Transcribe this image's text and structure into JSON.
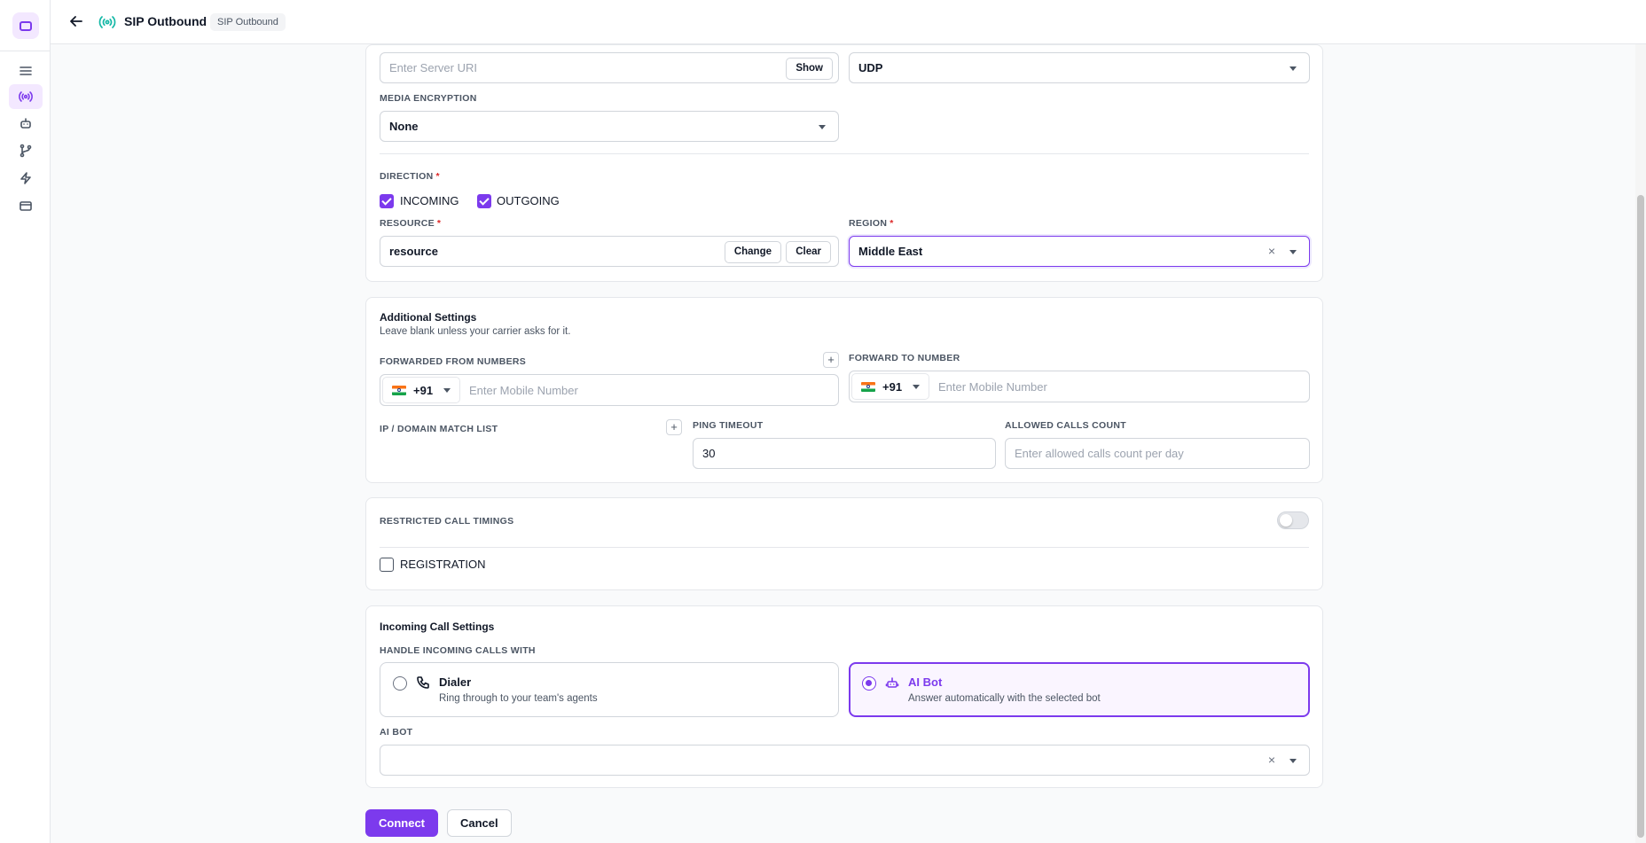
{
  "header": {
    "title": "SIP Outbound",
    "badge": "SIP Outbound"
  },
  "rail": {
    "icons": [
      "menu-icon",
      "broadcast-icon",
      "bot-icon",
      "branch-icon",
      "lightning-icon",
      "card-icon"
    ],
    "active": "broadcast-icon"
  },
  "connection": {
    "server_uri_placeholder": "Enter Server URI",
    "show_label": "Show",
    "transport_value": "UDP",
    "media_encryption_label": "MEDIA ENCRYPTION",
    "media_encryption_value": "None",
    "direction_label": "DIRECTION",
    "direction_required": "*",
    "incoming_label": "INCOMING",
    "incoming_checked": true,
    "outgoing_label": "OUTGOING",
    "outgoing_checked": true,
    "resource_label": "RESOURCE",
    "resource_required": "*",
    "resource_value": "resource",
    "change_label": "Change",
    "clear_label": "Clear",
    "region_label": "REGION",
    "region_required": "*",
    "region_value": "Middle East",
    "clear_icon": "×"
  },
  "additional": {
    "title": "Additional Settings",
    "subtitle": "Leave blank unless your carrier asks for it.",
    "forwarded_from_label": "FORWARDED FROM NUMBERS",
    "plus": "+",
    "country_code": "+91",
    "mobile_placeholder": "Enter Mobile Number",
    "forward_to_label": "FORWARD TO NUMBER",
    "ip_domain_label": "IP / DOMAIN MATCH LIST",
    "ping_timeout_label": "PING TIMEOUT",
    "ping_timeout_value": "30",
    "allowed_calls_label": "ALLOWED CALLS COUNT",
    "allowed_calls_placeholder": "Enter allowed calls count per day"
  },
  "timings": {
    "restricted_label": "RESTRICTED CALL TIMINGS",
    "restricted_on": false,
    "registration_label": "REGISTRATION",
    "registration_checked": false
  },
  "incoming": {
    "title": "Incoming Call Settings",
    "handle_label": "HANDLE INCOMING CALLS WITH",
    "options": [
      {
        "title": "Dialer",
        "desc": "Ring through to your team's agents",
        "selected": false
      },
      {
        "title": "AI Bot",
        "desc": "Answer automatically with the selected bot",
        "selected": true
      }
    ],
    "ai_bot_label": "AI BOT",
    "ai_bot_value": "",
    "clear_icon": "×"
  },
  "footer": {
    "connect_label": "Connect",
    "cancel_label": "Cancel"
  },
  "colors": {
    "accent": "#7c3aed",
    "teal": "#14b8a6",
    "required": "#dc2626"
  }
}
